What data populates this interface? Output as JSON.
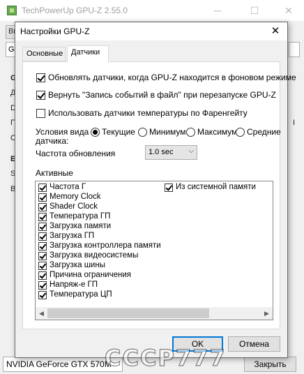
{
  "main_window": {
    "title": "TechPowerUp GPU-Z 2.55.0",
    "menu_stub": "Ви",
    "combo_stub": "Ge",
    "left_labels": [
      "G",
      "Д",
      "D",
      "П",
      "C",
      "E",
      "S",
      "Ві"
    ],
    "right_stub": "I",
    "gpu_name": "NVIDIA GeForce GTX 570M",
    "close_label": "Закрыть"
  },
  "watermark": "СССР777",
  "dialog": {
    "title": "Настройки GPU-Z",
    "close_glyph": "✕",
    "tabs": [
      {
        "label": "Основные",
        "active": false
      },
      {
        "label": "Датчики",
        "active": true
      }
    ],
    "options": [
      {
        "label": "Обновлять датчики, когда GPU-Z находится в фоновом режиме",
        "checked": true
      },
      {
        "label": "Вернуть \"Запись событий в файл\" при перезапуске GPU-Z",
        "checked": true
      },
      {
        "label": "Использовать датчики температуры по Фаренгейту",
        "checked": false
      }
    ],
    "view_label_1": "Условия вида",
    "view_label_2": "датчика:",
    "view_options": [
      {
        "label": "Текущие",
        "checked": true
      },
      {
        "label": "Минимум",
        "checked": false
      },
      {
        "label": "Максимум",
        "checked": false
      },
      {
        "label": "Средние",
        "checked": false
      }
    ],
    "refresh_label": "Частота обновления",
    "refresh_value": "1.0 sec",
    "active_label": "Активные",
    "sensors_col1": [
      {
        "label": "Частота Г",
        "checked": true
      },
      {
        "label": "Memory Clock",
        "checked": true
      },
      {
        "label": "Shader Clock",
        "checked": true
      },
      {
        "label": "Температура ГП",
        "checked": true
      },
      {
        "label": "Загрузка памяти",
        "checked": true
      },
      {
        "label": "Загрузка ГП",
        "checked": true
      },
      {
        "label": "Загрузка контроллера памяти",
        "checked": true
      },
      {
        "label": "Загрузка видеосистемы",
        "checked": true
      },
      {
        "label": "Загрузка шины",
        "checked": true
      },
      {
        "label": "Причина ограничения",
        "checked": true
      },
      {
        "label": "Напряж-е ГП",
        "checked": true
      },
      {
        "label": "Температура ЦП",
        "checked": true
      }
    ],
    "sensors_col2": [
      {
        "label": "Из системной памяти",
        "checked": true
      }
    ],
    "scroll_left": "◀",
    "scroll_right": "▶",
    "ok_label": "OK",
    "cancel_label": "Отмена"
  },
  "icons": {
    "app": "gpu-z-app-icon",
    "close": "close-icon",
    "chevron": "chevron-down-icon"
  }
}
